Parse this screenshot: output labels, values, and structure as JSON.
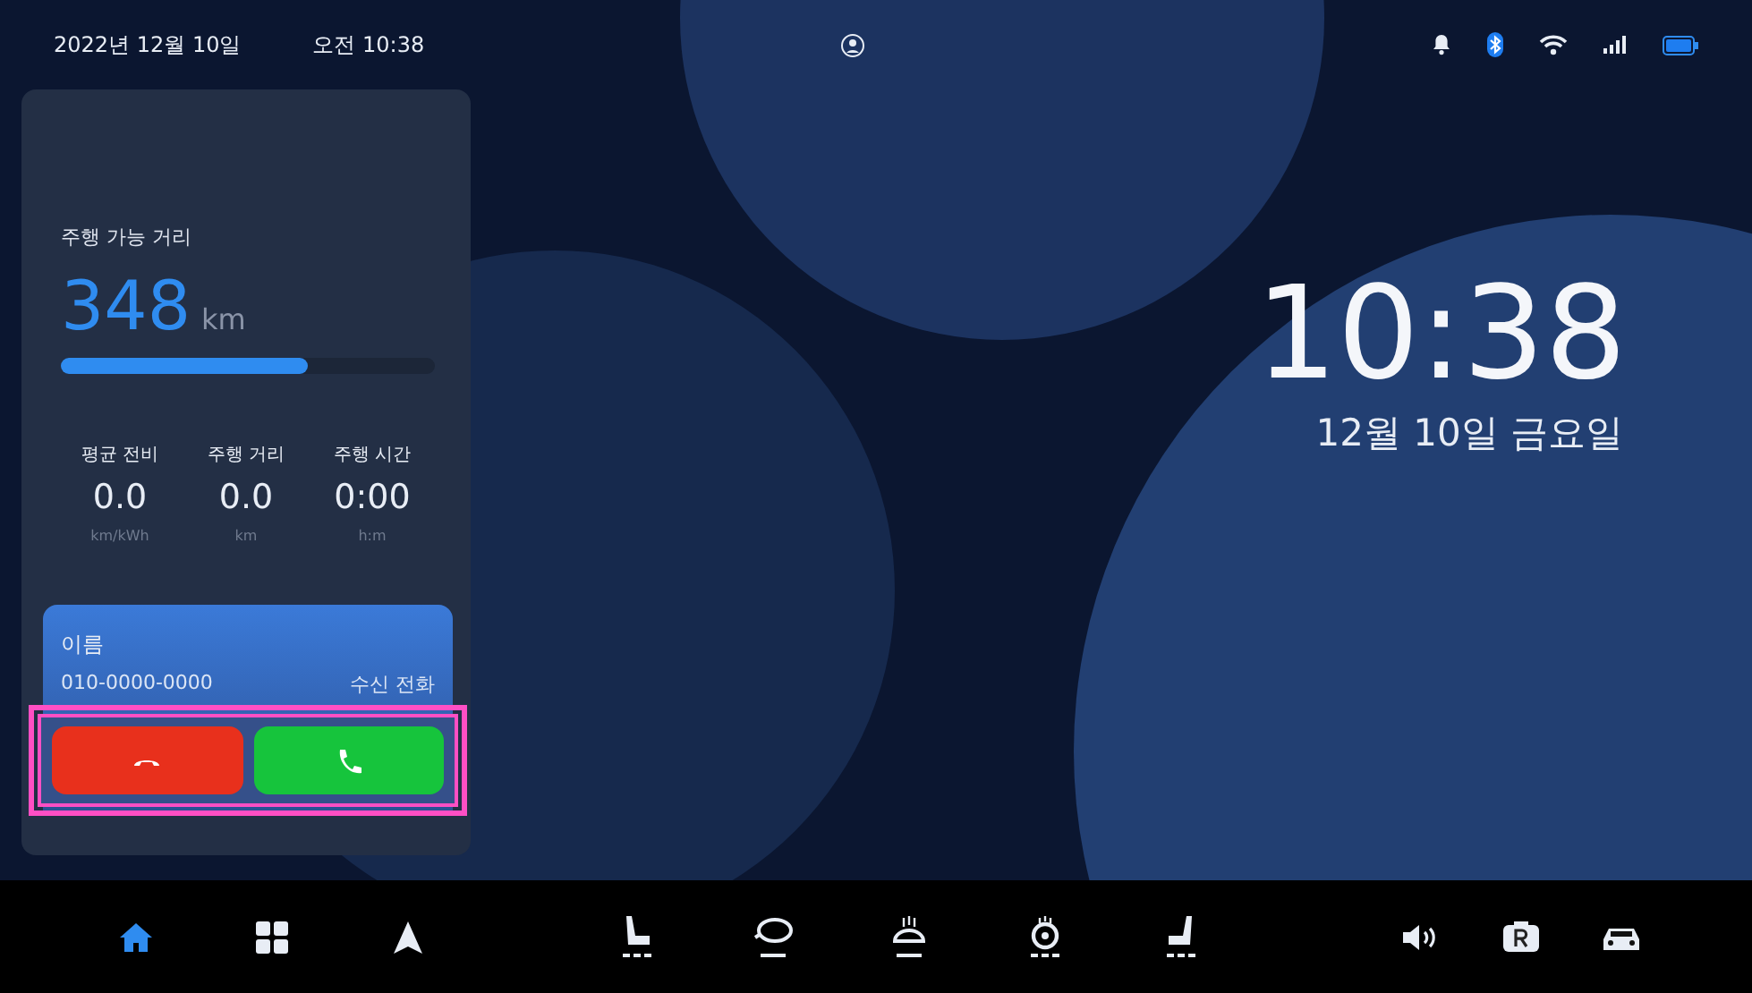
{
  "status_bar": {
    "date": "2022년 12월 10일",
    "time": "오전 10:38",
    "icons": [
      {
        "kind": "bell"
      },
      {
        "kind": "bluetooth"
      },
      {
        "kind": "wifi"
      },
      {
        "kind": "signal"
      },
      {
        "kind": "battery"
      }
    ]
  },
  "trip_card": {
    "range_label": "주행 가능 거리",
    "range_value": "348",
    "range_unit": "km",
    "level": 0.66,
    "stats": [
      {
        "label": "평균 전비",
        "value": "0.0",
        "unit": "km/kWh"
      },
      {
        "label": "주행 거리",
        "value": "0.0",
        "unit": "km"
      },
      {
        "label": "주행 시간",
        "value": "0:00",
        "unit": "h:m"
      }
    ]
  },
  "call": {
    "name": "이름",
    "number": "010-0000-0000",
    "status": "수신 전화"
  },
  "clock": {
    "time": "10:38",
    "date": "12월 10일 금요일"
  },
  "nav": {
    "left": [
      {
        "kind": "home",
        "selected": true
      },
      {
        "kind": "apps",
        "selected": false
      },
      {
        "kind": "navigation",
        "selected": false
      }
    ],
    "climate": [
      {
        "kind": "seat-left"
      },
      {
        "kind": "mirror"
      },
      {
        "kind": "defrost"
      },
      {
        "kind": "steering"
      },
      {
        "kind": "seat-right"
      }
    ],
    "right": [
      {
        "kind": "volume"
      },
      {
        "kind": "park"
      },
      {
        "kind": "car"
      }
    ]
  }
}
